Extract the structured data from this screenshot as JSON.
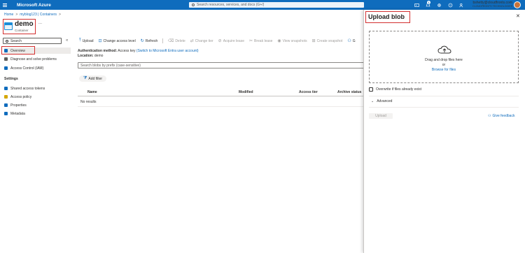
{
  "topbar": {
    "brand": "Microsoft Azure",
    "search_placeholder": "Search resources, services, and docs (G+/)",
    "notification_count": "1",
    "user_email": "bshetty@cloudfronts.com",
    "user_org": "CLOUDFRONTS TECHNOLOGIES",
    "accent": "#0f6cbd"
  },
  "breadcrumb": [
    "Home",
    "myblog123 | Containers"
  ],
  "header": {
    "title": "demo",
    "subtitle": "Container",
    "more": "..."
  },
  "nav": {
    "search_placeholder": "Search",
    "collapse": "«",
    "items": [
      {
        "label": "Overview",
        "icon": "overview-icon",
        "selected": true
      },
      {
        "label": "Diagnose and solve problems",
        "icon": "wrench-icon"
      },
      {
        "label": "Access Control (IAM)",
        "icon": "people-icon"
      }
    ],
    "settings_title": "Settings",
    "settings_items": [
      {
        "label": "Shared access tokens",
        "icon": "link-icon"
      },
      {
        "label": "Access policy",
        "icon": "key-icon"
      },
      {
        "label": "Properties",
        "icon": "properties-icon"
      },
      {
        "label": "Metadata",
        "icon": "metadata-icon"
      }
    ]
  },
  "toolbar": {
    "upload": "Upload",
    "change_access": "Change access level",
    "refresh": "Refresh",
    "delete": "Delete",
    "change_tier": "Change tier",
    "acquire_lease": "Acquire lease",
    "break_lease": "Break lease",
    "view_snapshots": "View snapshots",
    "create_snapshot": "Create snapshot",
    "more": "G"
  },
  "auth": {
    "label": "Authentication method:",
    "value": "Access key",
    "link": "(Switch to Microsoft Entra user account)",
    "location_label": "Location:",
    "location_value": "demo"
  },
  "blob_search_placeholder": "Search blobs by prefix (case-sensitive)",
  "add_filter": "Add filter",
  "table": {
    "headers": [
      "Name",
      "Modified",
      "Access tier",
      "Archive status"
    ],
    "empty": "No results"
  },
  "panel": {
    "title": "Upload blob",
    "close": "✕",
    "drag_text": "Drag and drop files here",
    "or": "or",
    "browse": "Browse for files",
    "overwrite": "Overwrite if files already exist",
    "advanced": "Advanced",
    "upload_button": "Upload",
    "feedback": "Give feedback"
  }
}
